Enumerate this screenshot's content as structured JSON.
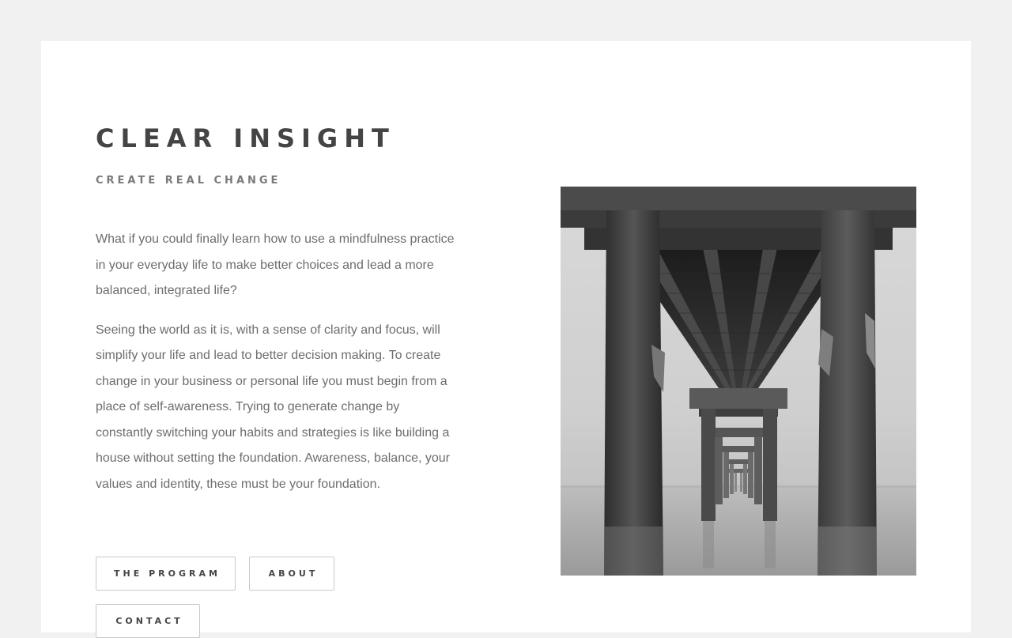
{
  "hero": {
    "title": "CLEAR INSIGHT",
    "subtitle": "CREATE REAL CHANGE",
    "paragraphs": [
      "What if you could finally learn how to use a mindfulness practice in your everyday life to make better choices and lead a more balanced, integrated life?",
      "Seeing the world as it is, with a sense of clarity and focus, will simplify your life and lead to better decision making. To create change in your business or personal life you must begin from a place of self-awareness. Trying to generate change by constantly switching your habits and strategies is like building a house without setting the foundation. Awareness, balance, your values and identity, these must be your foundation."
    ]
  },
  "buttons": {
    "program": "THE PROGRAM",
    "about": "ABOUT",
    "contact": "CONTACT"
  },
  "colors": {
    "page_background": "#f1f1f1",
    "card_background": "#ffffff",
    "heading": "#444444",
    "body_text": "#6d6d6d"
  }
}
